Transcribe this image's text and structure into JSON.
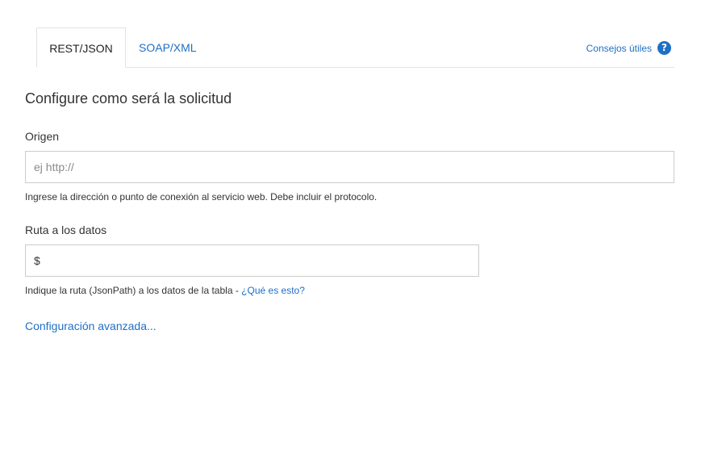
{
  "tabs": {
    "active_label": "REST/JSON",
    "inactive_label": "SOAP/XML"
  },
  "tips": {
    "label": "Consejos útiles",
    "icon": "help-circle-icon",
    "icon_glyph": "?"
  },
  "form": {
    "title": "Configure como será la solicitud",
    "origin": {
      "label": "Origen",
      "placeholder": "ej http://",
      "value": "",
      "help": "Ingrese la dirección o punto de conexión al servicio web. Debe incluir el protocolo."
    },
    "data_path": {
      "label": "Ruta a los datos",
      "value": "$",
      "help": "Indique la ruta (JsonPath) a los datos de la tabla - ",
      "help_link": "¿Qué es esto?"
    },
    "advanced_link": "Configuración avanzada..."
  },
  "colors": {
    "link": "#1f6fc5",
    "border": "#cccccc",
    "text": "#333333"
  }
}
